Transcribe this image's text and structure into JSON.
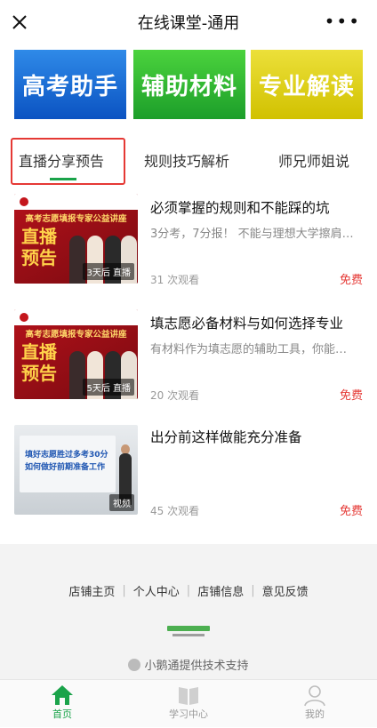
{
  "header": {
    "title": "在线课堂-通用"
  },
  "banners": [
    "高考助手",
    "辅助材料",
    "专业解读"
  ],
  "tabs": [
    "直播分享预告",
    "规则技巧解析",
    "师兄师姐说"
  ],
  "items": [
    {
      "title": "必须掌握的规则和不能踩的坑",
      "desc": "3分考，7分报！ 不能与理想大学擦肩…",
      "views": "31 次观看",
      "price": "免费",
      "thumb_header": "高考志愿填报专家公益讲座",
      "thumb_big": "直播预告",
      "badge": "3天后 直播"
    },
    {
      "title": "填志愿必备材料与如何选择专业",
      "desc": "有材料作为填志愿的辅助工具，你能…",
      "views": "20 次观看",
      "price": "免费",
      "thumb_header": "高考志愿填报专家公益讲座",
      "thumb_big": "直播预告",
      "badge": "5天后 直播"
    },
    {
      "title": "出分前这样做能充分准备",
      "desc": "",
      "views": "45 次观看",
      "price": "免费",
      "thumb_line1": "填好志愿胜过多考30分",
      "thumb_line2": "如何做好前期准备工作",
      "badge": "视频"
    }
  ],
  "footer": {
    "links": [
      "店铺主页",
      "个人中心",
      "店铺信息",
      "意见反馈"
    ],
    "support": "小鹅通提供技术支持"
  },
  "tabbar": [
    "首页",
    "学习中心",
    "我的"
  ],
  "colors": {
    "accent": "#1aa34a",
    "price": "#e53935",
    "highlight": "#e53935"
  }
}
